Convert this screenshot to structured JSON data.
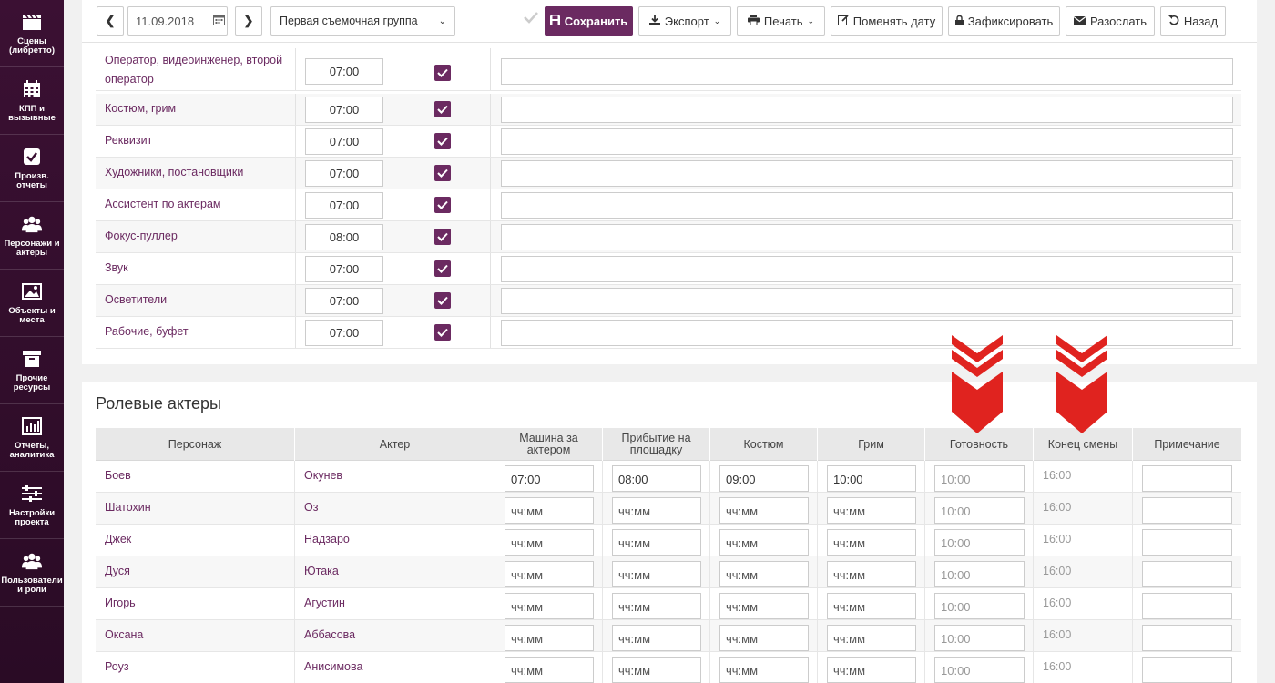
{
  "sidebar": {
    "items": [
      {
        "label": "Сцены (либретто)",
        "icon": "clapperboard-icon"
      },
      {
        "label": "КПП и вызывные",
        "icon": "calendar-icon"
      },
      {
        "label": "Произв. отчеты",
        "icon": "checkbox-icon"
      },
      {
        "label": "Персонажи и актеры",
        "icon": "people-icon"
      },
      {
        "label": "Объекты и места",
        "icon": "image-icon"
      },
      {
        "label": "Прочие ресурсы",
        "icon": "archive-icon"
      },
      {
        "label": "Отчеты, аналитика",
        "icon": "chart-icon"
      },
      {
        "label": "Настройки проекта",
        "icon": "sliders-icon"
      },
      {
        "label": "Пользователи и роли",
        "icon": "users-icon"
      }
    ]
  },
  "toolbar": {
    "prev": "❮",
    "next": "❯",
    "date": "11.09.2018",
    "group": "Первая съемочная группа",
    "save": "Сохранить",
    "export": "Экспорт",
    "print": "Печать",
    "change_date": "Поменять дату",
    "lock": "Зафиксировать",
    "send": "Разослать",
    "back": "Назад"
  },
  "crew": {
    "rows": [
      {
        "name": "Оператор, видеоинженер, второй оператор",
        "time": "07:00",
        "checked": true
      },
      {
        "name": "Костюм, грим",
        "time": "07:00",
        "checked": true
      },
      {
        "name": "Реквизит",
        "time": "07:00",
        "checked": true
      },
      {
        "name": "Художники, постановщики",
        "time": "07:00",
        "checked": true
      },
      {
        "name": "Ассистент по актерам",
        "time": "07:00",
        "checked": true
      },
      {
        "name": "Фокус-пуллер",
        "time": "08:00",
        "checked": true
      },
      {
        "name": "Звук",
        "time": "07:00",
        "checked": true
      },
      {
        "name": "Осветители",
        "time": "07:00",
        "checked": true
      },
      {
        "name": "Рабочие, буфет",
        "time": "07:00",
        "checked": true
      }
    ]
  },
  "actors": {
    "title": "Ролевые актеры",
    "headers": [
      "Персонаж",
      "Актер",
      "Машина за актером",
      "Прибытие на площадку",
      "Костюм",
      "Грим",
      "Готовность",
      "Конец смены",
      "Примечание"
    ],
    "rows": [
      {
        "character": "Боев",
        "actor": "Окунев",
        "car": "07:00",
        "arrival": "08:00",
        "costume": "09:00",
        "makeup": "10:00",
        "ready": "10:00",
        "end": "16:00"
      },
      {
        "character": "Шатохин",
        "actor": "Оз",
        "car": "чч:мм",
        "arrival": "чч:мм",
        "costume": "чч:мм",
        "makeup": "чч:мм",
        "ready": "10:00",
        "end": "16:00"
      },
      {
        "character": "Джек",
        "actor": "Надзаро",
        "car": "чч:мм",
        "arrival": "чч:мм",
        "costume": "чч:мм",
        "makeup": "чч:мм",
        "ready": "10:00",
        "end": "16:00"
      },
      {
        "character": "Дуся",
        "actor": "Ютака",
        "car": "чч:мм",
        "arrival": "чч:мм",
        "costume": "чч:мм",
        "makeup": "чч:мм",
        "ready": "10:00",
        "end": "16:00"
      },
      {
        "character": "Игорь",
        "actor": "Агустин",
        "car": "чч:мм",
        "arrival": "чч:мм",
        "costume": "чч:мм",
        "makeup": "чч:мм",
        "ready": "10:00",
        "end": "16:00"
      },
      {
        "character": "Оксана",
        "actor": "Аббасова",
        "car": "чч:мм",
        "arrival": "чч:мм",
        "costume": "чч:мм",
        "makeup": "чч:мм",
        "ready": "10:00",
        "end": "16:00"
      },
      {
        "character": "Роуз",
        "actor": "Анисимова",
        "car": "чч:мм",
        "arrival": "чч:мм",
        "costume": "чч:мм",
        "makeup": "чч:мм",
        "ready": "10:00",
        "end": "16:00"
      }
    ]
  },
  "colors": {
    "brand": "#6b2a61",
    "sidebar": "#3b1033",
    "arrow": "#e0231f"
  }
}
